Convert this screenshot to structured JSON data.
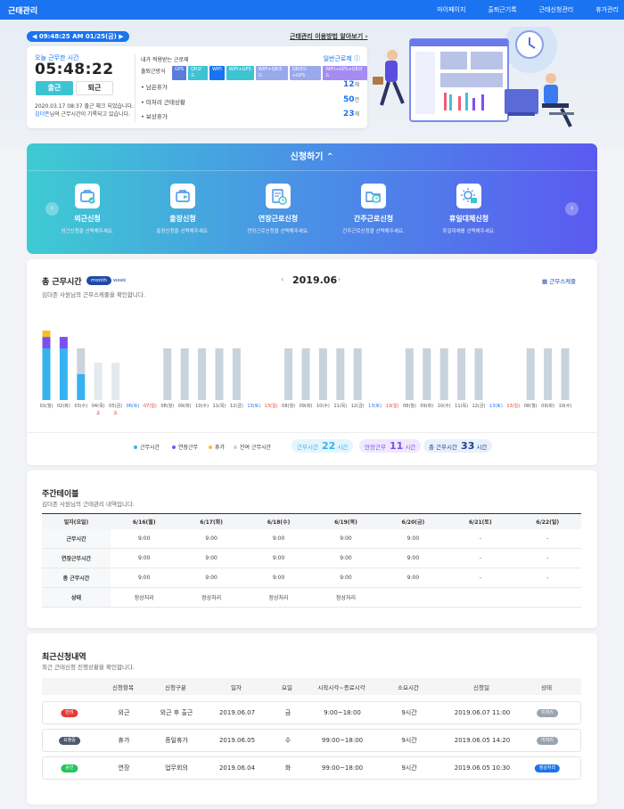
{
  "nav": {
    "logo": "근태관리",
    "links": [
      "마이페이지",
      "출퇴근기록",
      "근태신청관리",
      "휴가관리"
    ]
  },
  "clock": {
    "datetime": "09:48:25 AM 01/25(금)"
  },
  "howto_link": "근태관리 이용방법 알아보기",
  "today": {
    "label": "오늘 근무한 시간",
    "time": "05:48:22",
    "clock_in": "출근",
    "clock_out": "퇴근",
    "note1": "2020.03.17 08:37 출근 체크 되었습니다.",
    "note2_name": "김더존",
    "note2_rest": "님의 근무시간이 기록되고 있습니다."
  },
  "rule": {
    "title": "내가 적용받는 근로제",
    "link": "일반근로제",
    "method_label": "출퇴근방식",
    "methods": [
      {
        "label": "GPS",
        "color": "#5a7ddc"
      },
      {
        "label": "QR코드",
        "color": "#3ec3d3"
      },
      {
        "label": "WIFI",
        "color": "#1a73f0"
      },
      {
        "label": "WIFI+GPS",
        "color": "#3ec3d3"
      },
      {
        "label": "WIFI+QR코드",
        "color": "#9aa8ec"
      },
      {
        "label": "QR코드+GPS",
        "color": "#9aa8ec"
      },
      {
        "label": "WIFI+GPS+QR코드",
        "color": "#a48cf0"
      }
    ],
    "stats": [
      {
        "label": "• 남은휴가",
        "value": "12",
        "unit": "개"
      },
      {
        "label": "• 미처리 근태상황",
        "value": "50",
        "unit": "건"
      },
      {
        "label": "• 보상휴가",
        "value": "23",
        "unit": "개"
      }
    ]
  },
  "request": {
    "title": "신청하기 ⌃",
    "prev": "‹",
    "next": "›",
    "items": [
      {
        "title": "외근신청",
        "sub": "외근신청을 선택해주세요.",
        "icon": "briefcase-check-icon"
      },
      {
        "title": "출장신청",
        "sub": "출장신청을 선택해주세요.",
        "icon": "briefcase-plane-icon"
      },
      {
        "title": "연장근로신청",
        "sub": "연장근로신청을 선택해주세요.",
        "icon": "document-clock-icon"
      },
      {
        "title": "간주근로신청",
        "sub": "간주근로신청을 선택해주세요.",
        "icon": "folder-clock-icon"
      },
      {
        "title": "휴일대체신청",
        "sub": "휴일대체를 선택해주세요.",
        "icon": "sun-calendar-icon"
      }
    ]
  },
  "worktime": {
    "title": "총 근무시간",
    "tab_month": "month",
    "tab_week": "week",
    "sub": "김더존 사원님의 근무스케줄을 확인합니다.",
    "month_prev": "‹",
    "month": "2019.06",
    "month_next": "›",
    "schedule_btn": "근무스케줄",
    "legend": [
      {
        "label": "근무시간",
        "color": "#36b2f0"
      },
      {
        "label": "연장근무",
        "color": "#7c4ff2"
      },
      {
        "label": "휴가",
        "color": "#f5c024"
      },
      {
        "label": "잔여 근무시간",
        "color": "#c8d3dc"
      }
    ],
    "summary": [
      {
        "label": "근무시간",
        "value": "22",
        "unit": "시간",
        "color": "#36b2f0",
        "bg": "#e4f5fd"
      },
      {
        "label": "연장근무",
        "value": "11",
        "unit": "시간",
        "color": "#7c4ff2",
        "bg": "#efe9fd"
      },
      {
        "label": "총 근무시간",
        "value": "33",
        "unit": "시간",
        "color": "#1f3f8a",
        "bg": "#eaf0fb"
      }
    ]
  },
  "chart_data": {
    "type": "bar",
    "categories": [
      "01(월)",
      "02(화)",
      "03(수)",
      "04(목)",
      "05(금)",
      "06(토)",
      "07(일)",
      "08(월)",
      "09(화)",
      "10(수)",
      "11(목)",
      "12(금)",
      "13(토)",
      "13(일)",
      "08(월)",
      "09(화)",
      "10(수)",
      "11(목)",
      "12(금)",
      "13(토)",
      "13(일)",
      "08(월)",
      "09(화)",
      "10(수)",
      "11(목)",
      "12(금)",
      "13(토)",
      "13(일)",
      "08(월)",
      "09(화)",
      "10(수)"
    ],
    "label_colors": [
      "#555",
      "#555",
      "#555",
      "#555",
      "#555",
      "#1a73f0",
      "#e53935",
      "#555",
      "#555",
      "#555",
      "#555",
      "#555",
      "#1a73f0",
      "#e53935",
      "#555",
      "#555",
      "#555",
      "#555",
      "#555",
      "#1a73f0",
      "#e53935",
      "#555",
      "#555",
      "#555",
      "#555",
      "#555",
      "#1a73f0",
      "#e53935",
      "#555",
      "#555",
      "#555"
    ],
    "series": [
      {
        "name": "근무시간",
        "values": [
          9,
          9,
          4.5,
          0,
          0,
          0,
          0,
          0,
          0,
          0,
          0,
          0,
          0,
          0,
          0,
          0,
          0,
          0,
          0,
          0,
          0,
          0,
          0,
          0,
          0,
          0,
          0,
          0,
          0,
          0,
          0
        ]
      },
      {
        "name": "연장근무",
        "values": [
          2,
          2,
          0,
          0,
          0,
          0,
          0,
          0,
          0,
          0,
          0,
          0,
          0,
          0,
          0,
          0,
          0,
          0,
          0,
          0,
          0,
          0,
          0,
          0,
          0,
          0,
          0,
          0,
          0,
          0,
          0
        ]
      },
      {
        "name": "휴가",
        "values": [
          1.5,
          0,
          0,
          0,
          0,
          0,
          0,
          0,
          0,
          0,
          0,
          0,
          0,
          0,
          0,
          0,
          0,
          0,
          0,
          0,
          0,
          0,
          0,
          0,
          0,
          0,
          0,
          0,
          0,
          0,
          0
        ]
      },
      {
        "name": "잔여 근무시간",
        "values": [
          0,
          0,
          4.5,
          0,
          0,
          0,
          0,
          9,
          9,
          9,
          9,
          9,
          0,
          0,
          9,
          9,
          9,
          9,
          9,
          0,
          0,
          9,
          9,
          9,
          9,
          9,
          0,
          0,
          9,
          9,
          9
        ]
      }
    ],
    "vacation_days": [
      3,
      4
    ],
    "vacation_value": 6.5,
    "vacation_mark": "휴",
    "ylim": [
      0,
      14
    ]
  },
  "weekly": {
    "title": "주간테이블",
    "sub": "김더존 사원님의 근태관리 내역입니다.",
    "headers": [
      "일자(요일)",
      "6/16(월)",
      "6/17(화)",
      "6/18(수)",
      "6/19(목)",
      "6/20(금)",
      "6/21(토)",
      "6/22(일)"
    ],
    "rows": [
      [
        "근무시간",
        "9:00",
        "9:00",
        "9:00",
        "9:00",
        "9:00",
        "-",
        "-"
      ],
      [
        "연장근무시간",
        "9:00",
        "9:00",
        "9:00",
        "9:00",
        "9:00",
        "-",
        "-"
      ],
      [
        "총 근무시간",
        "9:00",
        "9:00",
        "9:00",
        "9:00",
        "9:00",
        "-",
        "-"
      ],
      [
        "상태",
        "정상처리",
        "정상처리",
        "정상처리",
        "정상처리",
        "",
        "",
        ""
      ]
    ]
  },
  "recent": {
    "title": "최근신청내역",
    "sub": "최근 근태신청 진행상황을 확인합니다.",
    "headers": [
      "신청항목",
      "신청구분",
      "일자",
      "요일",
      "시작시각~종료시각",
      "소요시간",
      "신청일",
      "상태"
    ],
    "rows": [
      {
        "badge": "반려",
        "badge_color": "#e53935",
        "cells": [
          "외근",
          "외근 후 출근",
          "2019.06.07",
          "금",
          "9:00~18:00",
          "9시간",
          "2019.06.07 11:00"
        ],
        "status": "미처리",
        "status_color": "#9aa3ad"
      },
      {
        "badge": "요청중",
        "badge_color": "#4d5b6e",
        "cells": [
          "휴가",
          "종일휴가",
          "2019.06.05",
          "수",
          "99:00~18:00",
          "9시간",
          "2019.06.05 14:20"
        ],
        "status": "미처리",
        "status_color": "#9aa3ad"
      },
      {
        "badge": "승인",
        "badge_color": "#22c55e",
        "cells": [
          "연장",
          "업무회의",
          "2019.06.04",
          "화",
          "99:00~18:00",
          "9시간",
          "2019.06.05 10:30"
        ],
        "status": "정상처리",
        "status_color": "#1a73f0"
      }
    ]
  }
}
